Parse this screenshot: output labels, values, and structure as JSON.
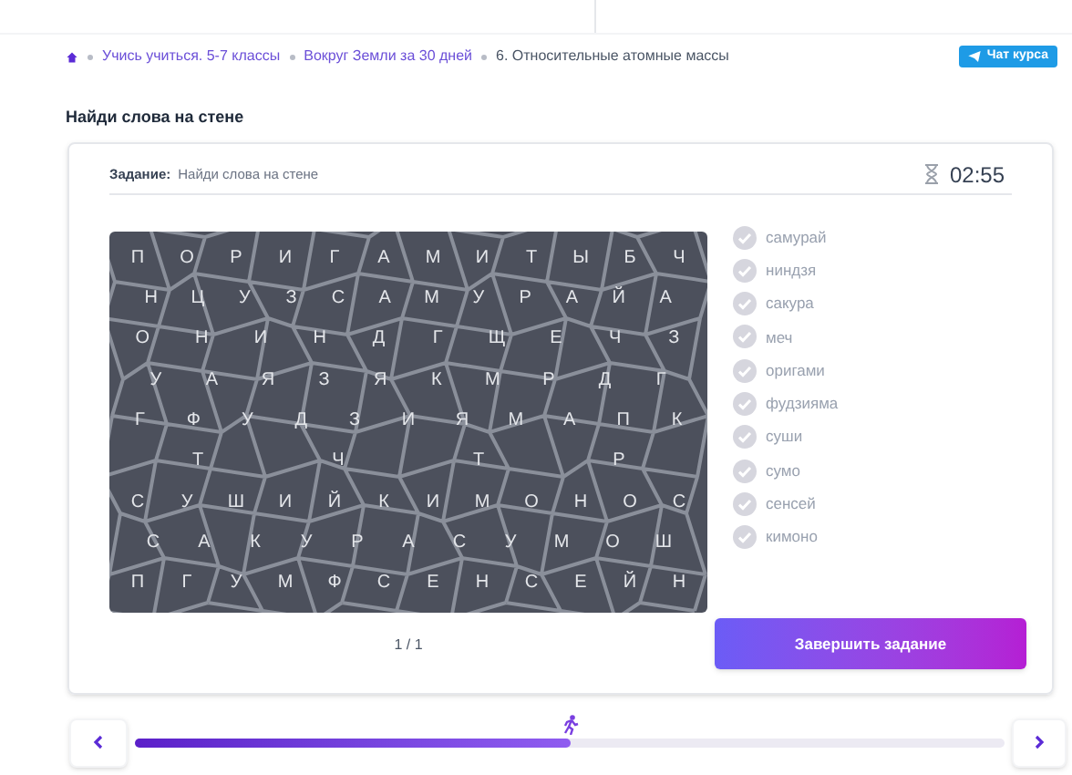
{
  "breadcrumbs": [
    {
      "label": "Учись учиться. 5-7 классы",
      "kind": "link"
    },
    {
      "label": "Вокруг Земли за 30 дней",
      "kind": "link"
    },
    {
      "label": "6. Относительные атомные массы",
      "kind": "current"
    }
  ],
  "chat_button": "Чат курса",
  "page_title": "Найди слова на стене",
  "task": {
    "label": "Задание:",
    "text": "Найди слова на стене",
    "timer": "02:55"
  },
  "wall_rows": [
    [
      "П",
      "О",
      "Р",
      "И",
      "Г",
      "А",
      "М",
      "И",
      "Т",
      "Ы",
      "Б",
      "Ч"
    ],
    [
      "Н",
      "Ц",
      "У",
      "З",
      "С",
      "А",
      "М",
      "У",
      "Р",
      "А",
      "Й",
      "А"
    ],
    [
      "О",
      "Н",
      "И",
      "Н",
      "Д",
      "Г",
      "Щ",
      "Е",
      "Ч",
      "З"
    ],
    [
      "У",
      "А",
      "Я",
      "З",
      "Я",
      "К",
      "М",
      "Р",
      "Д",
      "Г"
    ],
    [
      "Г",
      "Ф",
      "У",
      "Д",
      "З",
      "И",
      "Я",
      "М",
      "А",
      "П",
      "К"
    ],
    [
      "Т",
      "Ч",
      "Т",
      "Р"
    ],
    [
      "С",
      "У",
      "Ш",
      "И",
      "Й",
      "К",
      "И",
      "М",
      "О",
      "Н",
      "О",
      "С"
    ],
    [
      "С",
      "А",
      "К",
      "У",
      "Р",
      "А",
      "С",
      "У",
      "М",
      "О",
      "Ш"
    ],
    [
      "П",
      "Г",
      "У",
      "М",
      "Ф",
      "С",
      "Е",
      "Н",
      "С",
      "Е",
      "Й",
      "Н"
    ]
  ],
  "words": [
    {
      "text": "самурай",
      "found": false
    },
    {
      "text": "ниндзя",
      "found": false
    },
    {
      "text": "сакура",
      "found": false
    },
    {
      "text": "меч",
      "found": false
    },
    {
      "text": "оригами",
      "found": false
    },
    {
      "text": "фудзияма",
      "found": false
    },
    {
      "text": "суши",
      "found": false
    },
    {
      "text": "сумо",
      "found": false
    },
    {
      "text": "сенсей",
      "found": false
    },
    {
      "text": "кимоно",
      "found": false
    }
  ],
  "page_counter": "1 / 1",
  "finish_button": "Завершить задание",
  "progress": {
    "level": 0.5
  }
}
